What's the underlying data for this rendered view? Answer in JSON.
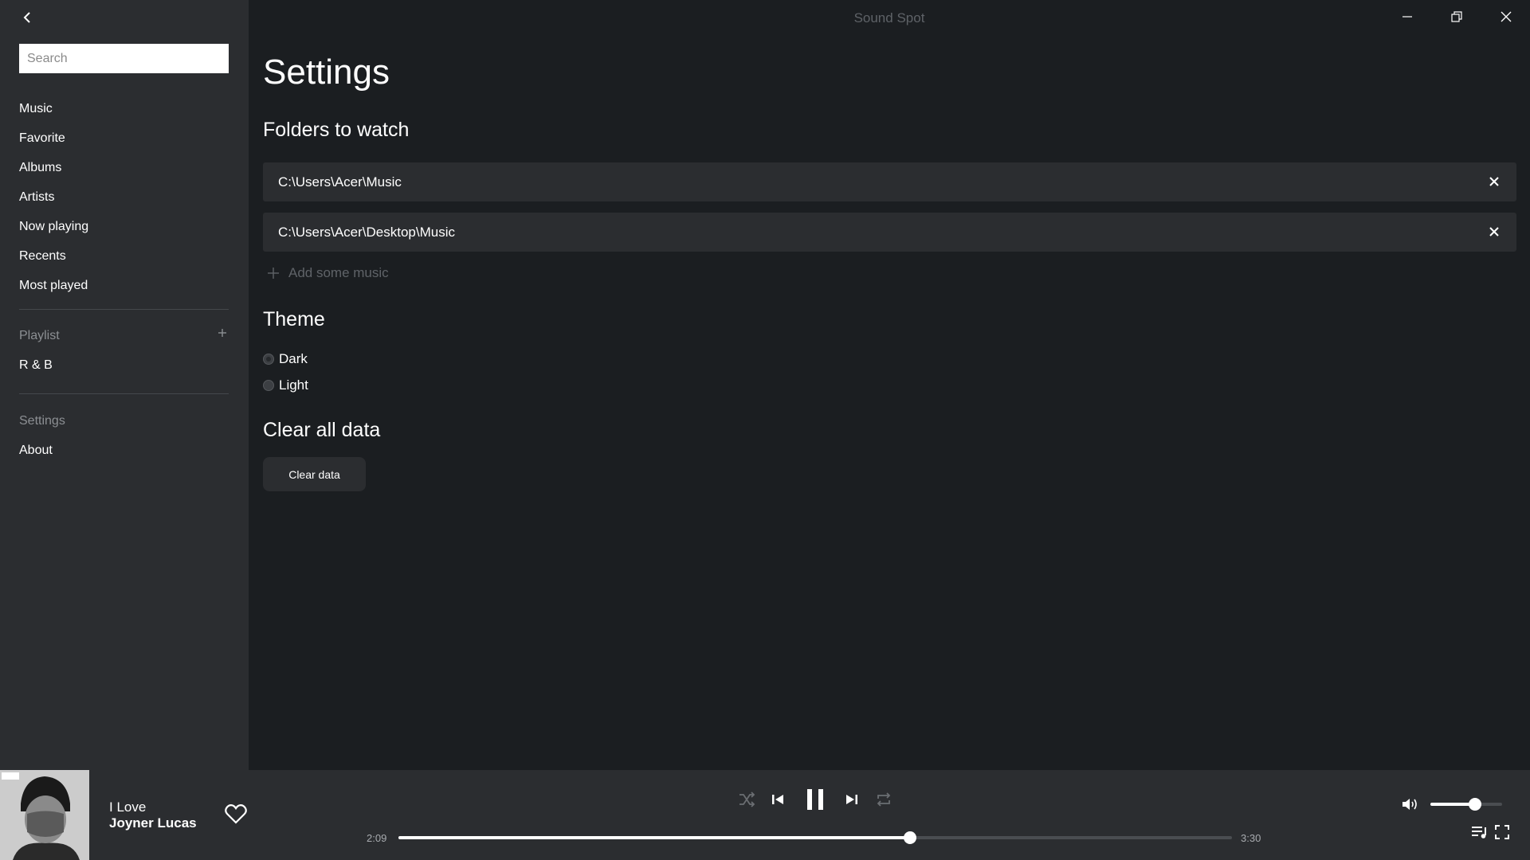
{
  "app": {
    "title": "Sound Spot"
  },
  "sidebar": {
    "search_placeholder": "Search",
    "nav": [
      "Music",
      "Favorite",
      "Albums",
      "Artists",
      "Now playing",
      "Recents",
      "Most played"
    ],
    "playlist_header": "Playlist",
    "playlists": [
      "R & B"
    ],
    "settings_label": "Settings",
    "about_label": "About"
  },
  "settings": {
    "title": "Settings",
    "folders_heading": "Folders to watch",
    "folders": [
      "C:\\Users\\Acer\\Music",
      "C:\\Users\\Acer\\Desktop\\Music"
    ],
    "add_music_label": "Add some music",
    "theme_heading": "Theme",
    "theme_options": [
      "Dark",
      "Light"
    ],
    "theme_selected": "Dark",
    "clear_heading": "Clear all data",
    "clear_button": "Clear data"
  },
  "player": {
    "track_title": "I Love",
    "artist": "Joyner Lucas",
    "elapsed": "2:09",
    "duration": "3:30",
    "progress_fraction": 0.614,
    "volume_fraction": 0.62,
    "state": "playing"
  },
  "colors": {
    "background": "#1b1e21",
    "sidebar": "#2b2d30",
    "muted_text": "#8c8f93",
    "accent": "#ffffff"
  }
}
